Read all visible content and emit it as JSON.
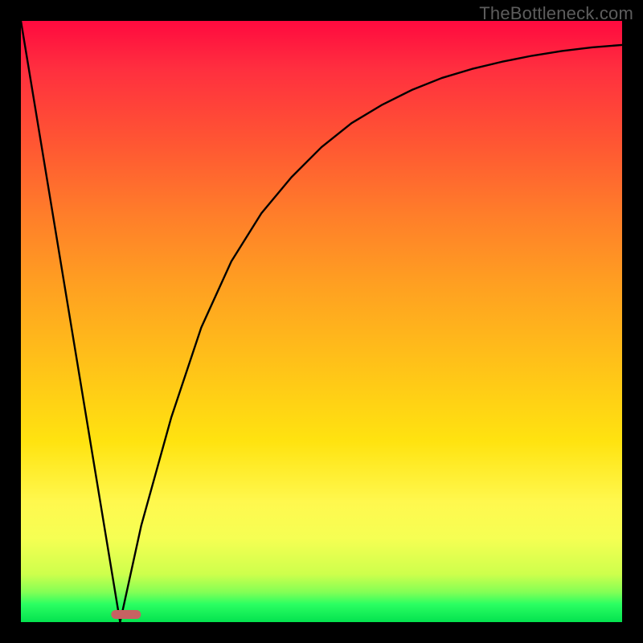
{
  "watermark": "TheBottleneck.com",
  "chart_data": {
    "type": "line",
    "title": "",
    "xlabel": "",
    "ylabel": "",
    "xlim": [
      0,
      100
    ],
    "ylim": [
      0,
      100
    ],
    "grid": false,
    "legend": false,
    "series": [
      {
        "name": "left-descent",
        "x": [
          0,
          16.5
        ],
        "y": [
          100,
          0
        ]
      },
      {
        "name": "right-curve",
        "x": [
          16.5,
          20,
          25,
          30,
          35,
          40,
          45,
          50,
          55,
          60,
          65,
          70,
          75,
          80,
          85,
          90,
          95,
          100
        ],
        "y": [
          0,
          16,
          34,
          49,
          60,
          68,
          74,
          79,
          83,
          86,
          88.5,
          90.5,
          92,
          93.2,
          94.2,
          95,
          95.6,
          96
        ]
      }
    ],
    "marker": {
      "x": 17.5,
      "width_pct": 5.0
    },
    "colors": {
      "gradient_top": "#ff0a3f",
      "gradient_bottom": "#04e24f",
      "curve": "#000000",
      "marker": "#c76262",
      "frame": "#000000"
    }
  }
}
